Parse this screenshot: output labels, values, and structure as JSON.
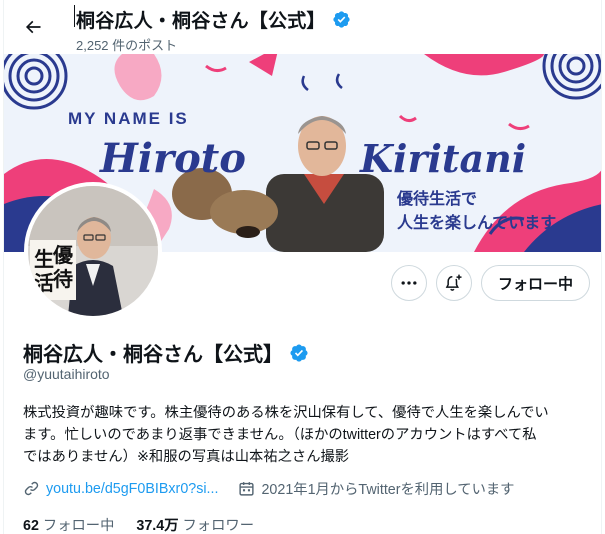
{
  "header": {
    "title": "桐谷広人・桐谷さん【公式】",
    "post_count": "2,252 件のポスト",
    "back_icon": "arrow-left-icon"
  },
  "banner": {
    "line1": "MY NAME IS",
    "first_name": "Hiroto",
    "last_name": "Kiritani",
    "tagline1": "優待生活で",
    "tagline2": "人生を楽しんでいます",
    "colors": {
      "background": "#eef3fb",
      "pink": "#ee3f7a",
      "navy": "#2a3a8f",
      "light_pink": "#f7a9c4"
    }
  },
  "avatar": {
    "sign_text1": "生",
    "sign_text2": "優",
    "sign_text3": "活",
    "sign_text4": "待"
  },
  "actions": {
    "more_icon": "more-icon",
    "notify_icon": "notification-add-icon",
    "follow_label": "フォロー中"
  },
  "profile": {
    "display_name": "桐谷広人・桐谷さん【公式】",
    "handle": "@yuutaihiroto",
    "bio_lines": [
      "株式投資が趣味です。株主優待のある株を沢山保有して、優待で人生を楽しんでい",
      "ます。忙しいのであまり返事できません。（ほかのtwitterのアカウントはすべて私",
      "ではありません）※和服の写真は山本祐之さん撮影"
    ],
    "link": "youtu.be/d5gF0BIBxr0?si...",
    "joined": "2021年1月からTwitterを利用しています",
    "verified_color": "#1d9bf0"
  },
  "stats": {
    "following_count": "62",
    "following_label": "フォロー中",
    "followers_count": "37.4万",
    "followers_label": "フォロワー"
  }
}
